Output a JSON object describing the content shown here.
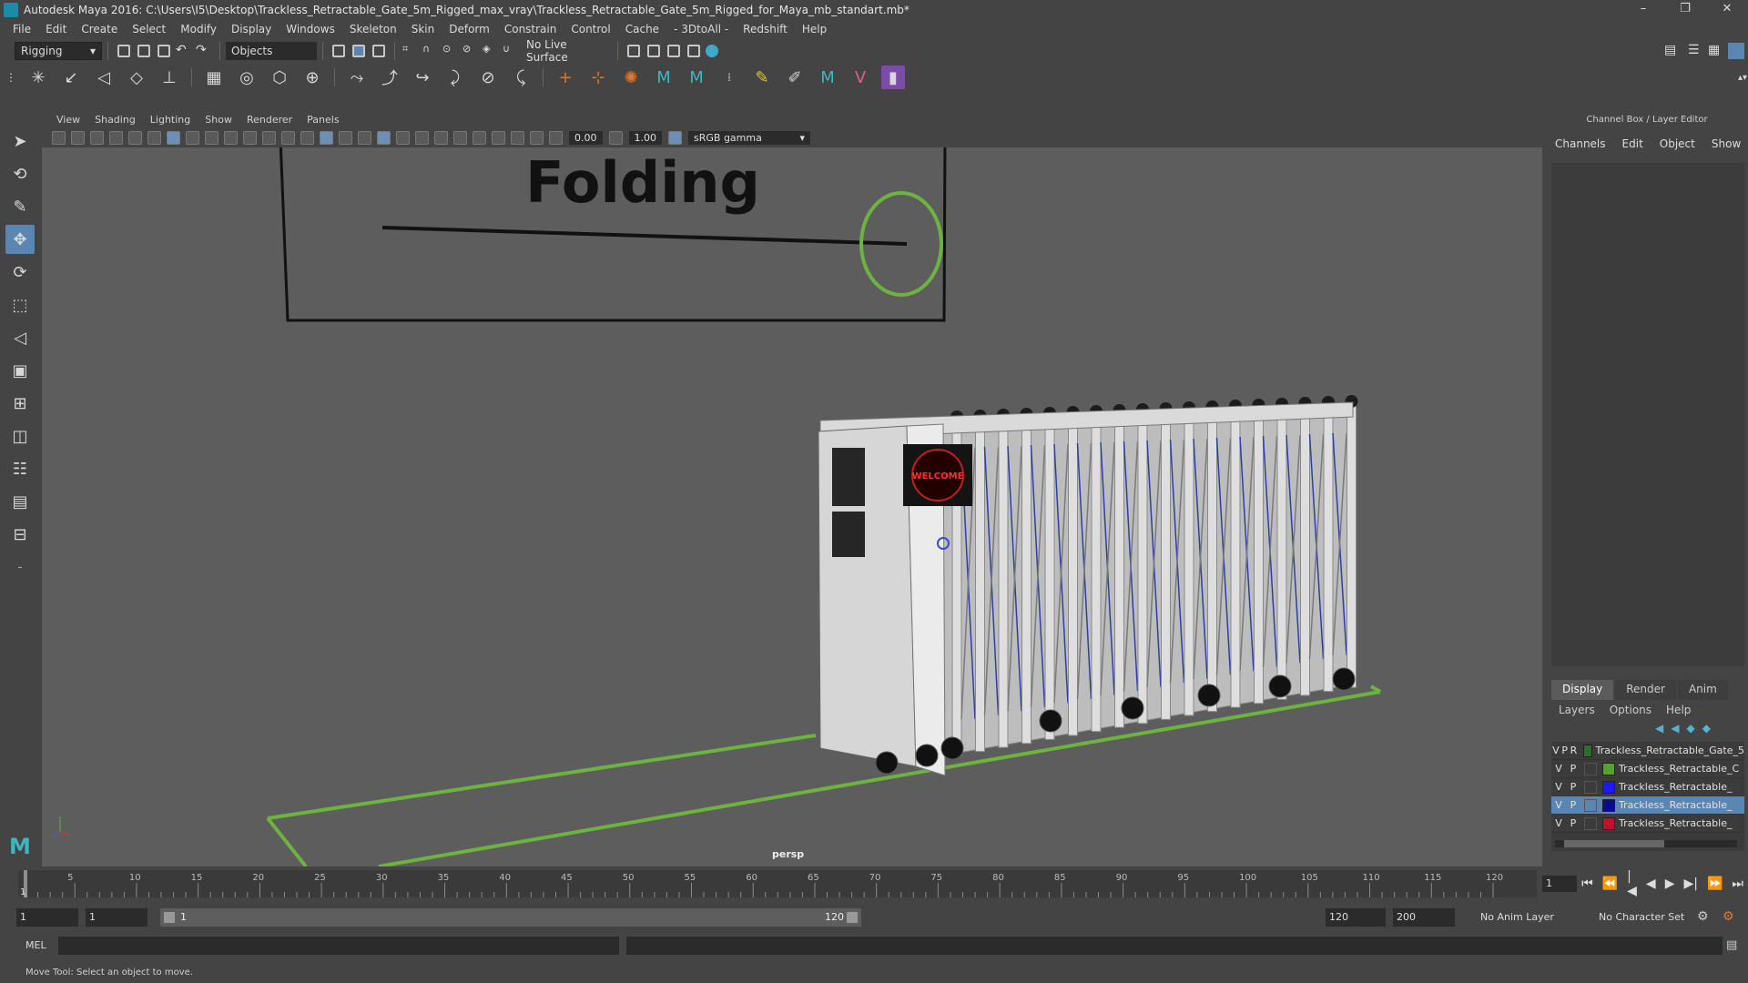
{
  "app": {
    "title": "Autodesk Maya 2016: C:\\Users\\I5\\Desktop\\Trackless_Retractable_Gate_5m_Rigged_max_vray\\Trackless_Retractable_Gate_5m_Rigged_for_Maya_mb_standart.mb*"
  },
  "menubar": [
    "File",
    "Edit",
    "Create",
    "Select",
    "Modify",
    "Display",
    "Windows",
    "Skeleton",
    "Skin",
    "Deform",
    "Constrain",
    "Control",
    "Cache",
    "- 3DtoAll -",
    "Redshift",
    "Help"
  ],
  "statusline": {
    "mode": "Rigging",
    "selection_mode": "Objects",
    "live_surface": "No Live Surface"
  },
  "panel": {
    "menus": [
      "View",
      "Shading",
      "Lighting",
      "Show",
      "Renderer",
      "Panels"
    ],
    "exposure": "0.00",
    "gamma": "1.00",
    "color_space": "sRGB gamma",
    "camera": "persp"
  },
  "scene": {
    "sign_text": "Folding",
    "welcome_text": "WELCOME",
    "colors": {
      "viewport_bg": "#5d5d5d",
      "control_green": "#6db33f",
      "gate_white": "#d8d8d8",
      "accent_blue": "#5a86b4"
    }
  },
  "channel_box": {
    "header": "Channel Box / Layer Editor",
    "menus": [
      "Channels",
      "Edit",
      "Object",
      "Show"
    ]
  },
  "layer_editor": {
    "tabs": [
      "Display",
      "Render",
      "Anim"
    ],
    "active_tab": "Display",
    "menus": [
      "Layers",
      "Options",
      "Help"
    ],
    "layers": [
      {
        "v": "V",
        "p": "P",
        "r": "R",
        "color": "#2e6b2e",
        "name": "Trackless_Retractable_Gate_5",
        "selected": false
      },
      {
        "v": "V",
        "p": "P",
        "r": "",
        "color": "#5aa02a",
        "name": "Trackless_Retractable_C",
        "selected": false
      },
      {
        "v": "V",
        "p": "P",
        "r": "",
        "color": "#1a1aff",
        "name": "Trackless_Retractable_",
        "selected": false
      },
      {
        "v": "V",
        "p": "P",
        "r": "",
        "color": "#0a0a90",
        "name": "Trackless_Retractable_",
        "selected": true
      },
      {
        "v": "V",
        "p": "P",
        "r": "",
        "color": "#c01030",
        "name": "Trackless_Retractable_",
        "selected": false
      }
    ]
  },
  "timeline": {
    "ticks": [
      5,
      10,
      15,
      20,
      25,
      30,
      35,
      40,
      45,
      50,
      55,
      60,
      65,
      70,
      75,
      80,
      85,
      90,
      95,
      100,
      105,
      110,
      115,
      120
    ],
    "start_label": "1",
    "current_frame": "1"
  },
  "range": {
    "start": "1",
    "start2": "1",
    "range_start": "1",
    "range_end": "120",
    "end": "120",
    "end2": "200",
    "anim_layer": "No Anim Layer",
    "char_set": "No Character Set"
  },
  "cmdline": {
    "label": "MEL"
  },
  "helpline": {
    "text": "Move Tool: Select an object to move."
  }
}
